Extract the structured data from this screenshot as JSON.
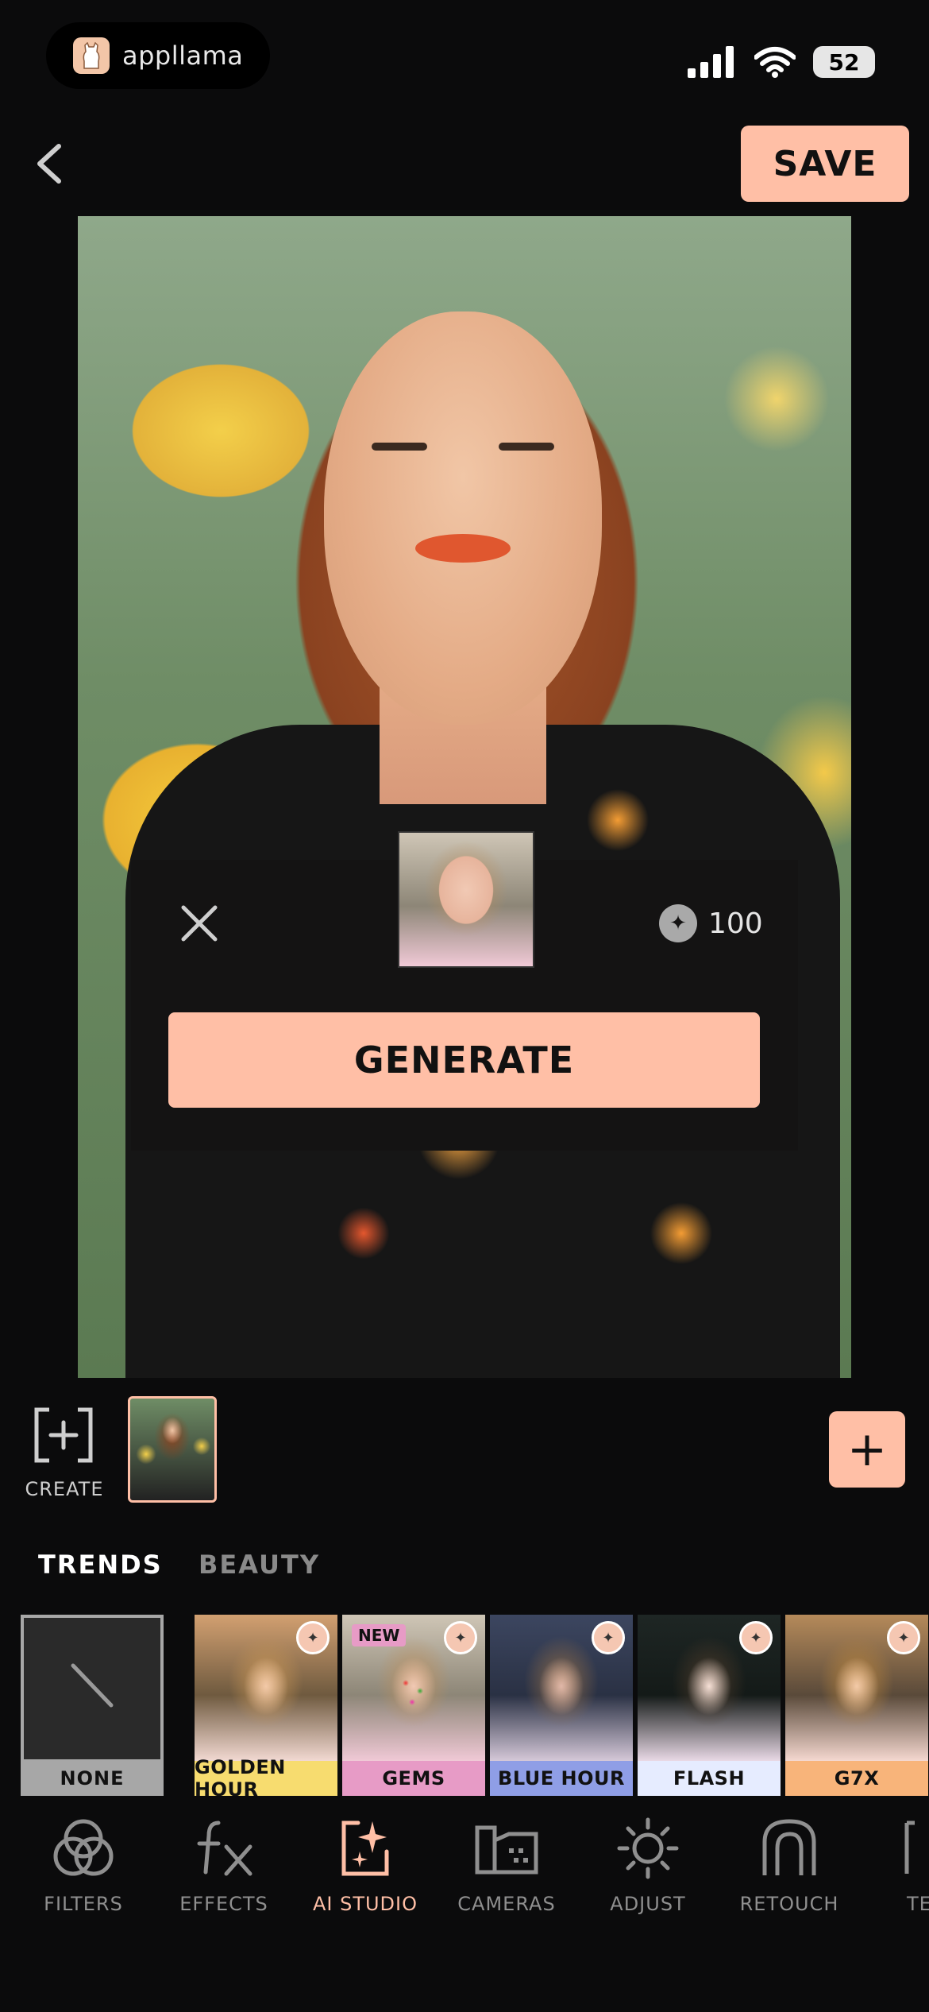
{
  "status_bar": {
    "app_name": "appllama",
    "battery": "52"
  },
  "header": {
    "save_label": "SAVE"
  },
  "generate_panel": {
    "cost": "100",
    "button_label": "GENERATE"
  },
  "layers": {
    "create_label": "CREATE",
    "add_label": "+"
  },
  "tabs": [
    {
      "label": "TRENDS",
      "active": true
    },
    {
      "label": "BEAUTY",
      "active": false
    }
  ],
  "filters": {
    "none_label": "NONE",
    "items": [
      {
        "label": "GOLDEN HOUR",
        "color": "#f7dc6f",
        "new": false
      },
      {
        "label": "GEMS",
        "color": "#e79bc6",
        "new": true,
        "new_label": "NEW"
      },
      {
        "label": "BLUE HOUR",
        "color": "#8f9ee6",
        "new": false
      },
      {
        "label": "FLASH",
        "color": "#e6ecff",
        "new": false
      },
      {
        "label": "G7X",
        "color": "#f8b47a",
        "new": false
      }
    ]
  },
  "nav": [
    {
      "label": "FILTERS",
      "icon": "filters-icon"
    },
    {
      "label": "EFFECTS",
      "icon": "effects-icon"
    },
    {
      "label": "AI STUDIO",
      "icon": "ai-studio-icon",
      "active": true
    },
    {
      "label": "CAMERAS",
      "icon": "cameras-icon"
    },
    {
      "label": "ADJUST",
      "icon": "adjust-icon"
    },
    {
      "label": "RETOUCH",
      "icon": "retouch-icon"
    },
    {
      "label": "TE",
      "icon": "text-icon"
    }
  ],
  "colors": {
    "accent": "#ffbfa6",
    "background": "#0b0b0c"
  }
}
